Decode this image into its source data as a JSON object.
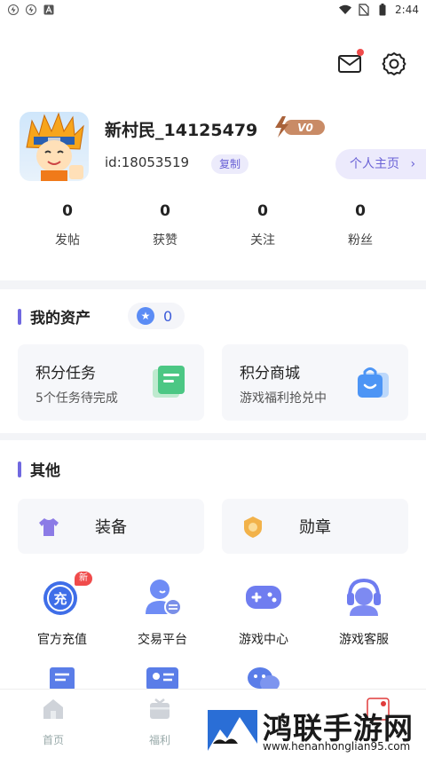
{
  "status_bar": {
    "time": "2:44"
  },
  "profile": {
    "nickname": "新村民_14125479",
    "vip_label": "V0",
    "user_id": "id:18053519",
    "copy_label": "复制",
    "homepage_label": "个人主页",
    "stats": [
      {
        "value": "0",
        "label": "发帖"
      },
      {
        "value": "0",
        "label": "获赞"
      },
      {
        "value": "0",
        "label": "关注"
      },
      {
        "value": "0",
        "label": "粉丝"
      }
    ]
  },
  "assets": {
    "title": "我的资产",
    "points": "0",
    "cards": [
      {
        "title": "积分任务",
        "subtitle": "5个任务待完成"
      },
      {
        "title": "积分商城",
        "subtitle": "游戏福利抢兑中"
      }
    ]
  },
  "other": {
    "title": "其他",
    "buttons": [
      {
        "label": "装备"
      },
      {
        "label": "勋章"
      }
    ],
    "grid": [
      {
        "label": "官方充值",
        "badge": "新",
        "icon_text": "充"
      },
      {
        "label": "交易平台"
      },
      {
        "label": "游戏中心"
      },
      {
        "label": "游戏客服"
      }
    ]
  },
  "tabs": [
    {
      "label": "首页"
    },
    {
      "label": "福利"
    }
  ],
  "watermark": {
    "text": "鸿联手游网",
    "url": "www.henanhonglian95.com"
  },
  "colors": {
    "accent": "#7068e0",
    "badge_red": "#f04b4b",
    "blue": "#5b8cf5",
    "green": "#4cc784"
  }
}
